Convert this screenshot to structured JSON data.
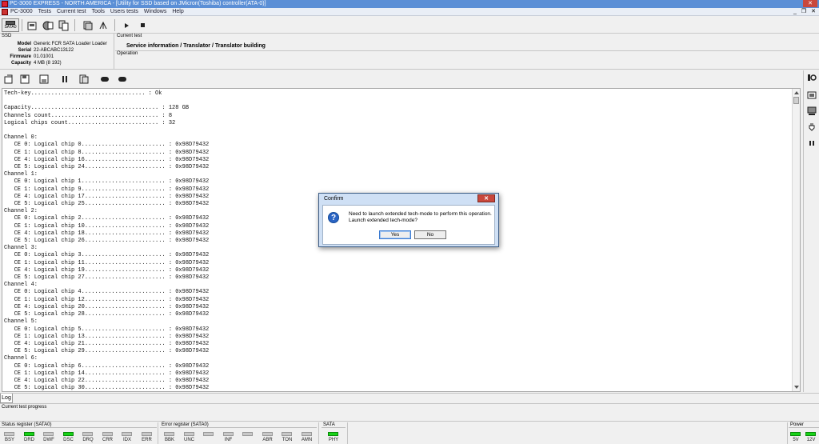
{
  "window": {
    "title": "PC-3000 EXPRESS - NORTH AMERICA - [Utility for SSD based on JMicron(Toshiba) controller(ATA-0)]",
    "close_label": "✕"
  },
  "menu": {
    "items": [
      "PC-3000",
      "Tests",
      "Current test",
      "Tools",
      "Users tests",
      "Windows",
      "Help"
    ],
    "window_controls": [
      "_",
      "❐",
      "✕"
    ]
  },
  "toolbar": {
    "sata_label": "SATA0"
  },
  "ssd": {
    "section_label": "SSD",
    "fields": [
      {
        "key": "Model",
        "value": "Generic FCR SATA Loader Loader"
      },
      {
        "key": "Serial",
        "value": "22-ABCABC13122"
      },
      {
        "key": "Firmware",
        "value": "01.01001"
      },
      {
        "key": "Capacity",
        "value": "4 MB (8 192)"
      }
    ]
  },
  "current_test": {
    "label": "Current test",
    "value": "Service information / Translator / Translator building",
    "operation_label": "Operation"
  },
  "log": {
    "lines": [
      "Tech-key.................................. : Ok",
      "",
      "Capacity...................................... : 128 GB",
      "Channels count................................ : 8",
      "Logical chips count........................... : 32",
      "",
      "Channel 0:",
      "   CE 0: Logical chip 0......................... : 0x98D79432",
      "   CE 1: Logical chip 8......................... : 0x98D79432",
      "   CE 4: Logical chip 16........................ : 0x98D79432",
      "   CE 5: Logical chip 24........................ : 0x98D79432",
      "Channel 1:",
      "   CE 0: Logical chip 1......................... : 0x98D79432",
      "   CE 1: Logical chip 9......................... : 0x98D79432",
      "   CE 4: Logical chip 17........................ : 0x98D79432",
      "   CE 5: Logical chip 25........................ : 0x98D79432",
      "Channel 2:",
      "   CE 0: Logical chip 2......................... : 0x98D79432",
      "   CE 1: Logical chip 10........................ : 0x98D79432",
      "   CE 4: Logical chip 18........................ : 0x98D79432",
      "   CE 5: Logical chip 26........................ : 0x98D79432",
      "Channel 3:",
      "   CE 0: Logical chip 3......................... : 0x98D79432",
      "   CE 1: Logical chip 11........................ : 0x98D79432",
      "   CE 4: Logical chip 19........................ : 0x98D79432",
      "   CE 5: Logical chip 27........................ : 0x98D79432",
      "Channel 4:",
      "   CE 0: Logical chip 4......................... : 0x98D79432",
      "   CE 1: Logical chip 12........................ : 0x98D79432",
      "   CE 4: Logical chip 20........................ : 0x98D79432",
      "   CE 5: Logical chip 28........................ : 0x98D79432",
      "Channel 5:",
      "   CE 0: Logical chip 5......................... : 0x98D79432",
      "   CE 1: Logical chip 13........................ : 0x98D79432",
      "   CE 4: Logical chip 21........................ : 0x98D79432",
      "   CE 5: Logical chip 29........................ : 0x98D79432",
      "Channel 6:",
      "   CE 0: Logical chip 6......................... : 0x98D79432",
      "   CE 1: Logical chip 14........................ : 0x98D79432",
      "   CE 4: Logical chip 22........................ : 0x98D79432",
      "   CE 5: Logical chip 30........................ : 0x98D79432"
    ]
  },
  "tabs": {
    "log_tab": "Log",
    "progress_label": "Current test progress"
  },
  "status_register": {
    "title": "Status register (SATA0)",
    "leds": [
      {
        "label": "BSY",
        "on": false
      },
      {
        "label": "DRD",
        "on": true
      },
      {
        "label": "DWF",
        "on": false
      },
      {
        "label": "DSC",
        "on": true
      },
      {
        "label": "DRQ",
        "on": false
      },
      {
        "label": "CRR",
        "on": false
      },
      {
        "label": "IDX",
        "on": false
      },
      {
        "label": "ERR",
        "on": false
      }
    ]
  },
  "error_register": {
    "title": "Error register (SATA0)",
    "leds": [
      {
        "label": "BBK",
        "on": false
      },
      {
        "label": "UNC",
        "on": false
      },
      {
        "label": "",
        "on": false
      },
      {
        "label": "INF",
        "on": false
      },
      {
        "label": "",
        "on": false
      },
      {
        "label": "ABR",
        "on": false
      },
      {
        "label": "TON",
        "on": false
      },
      {
        "label": "AMN",
        "on": false
      }
    ]
  },
  "sata": {
    "title": "SATA",
    "leds": [
      {
        "label": "PHY",
        "on": true
      }
    ]
  },
  "power": {
    "title": "Power",
    "leds": [
      {
        "label": "5V",
        "on": true
      },
      {
        "label": "12V",
        "on": true
      }
    ]
  },
  "dialog": {
    "title": "Confirm",
    "close_label": "✕",
    "message_line1": "Need to launch extended tech-mode to perform this operation.",
    "message_line2": "Launch extended tech-mode?",
    "yes_label": "Yes",
    "no_label": "No"
  },
  "colors": {
    "led_on": "#18d318",
    "led_off": "#c8c8c8",
    "title_bar": "#5b8fd6",
    "dialog_icon": "#2a64c4"
  }
}
